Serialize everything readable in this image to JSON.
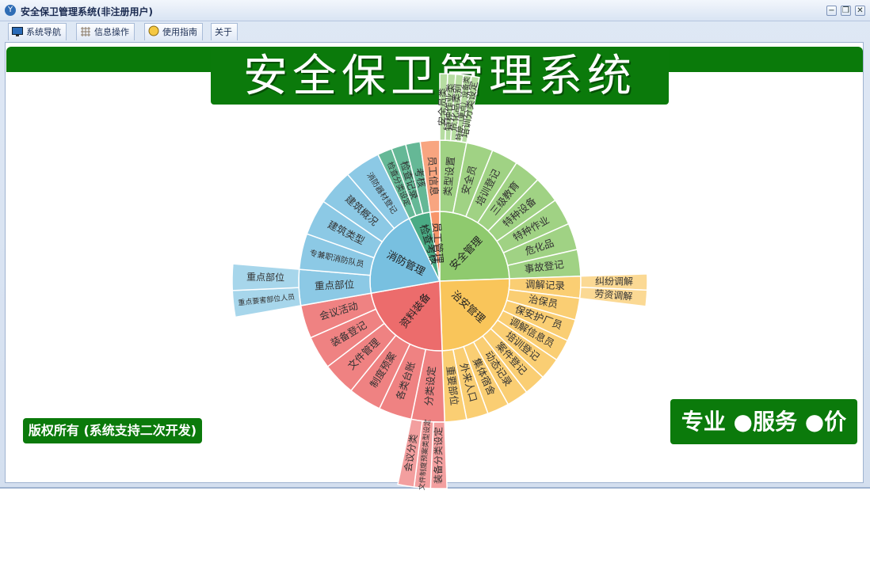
{
  "window": {
    "title": "安全保卫管理系统(非注册用户)",
    "controls": [
      "minimize",
      "restore",
      "close"
    ]
  },
  "toolbar": {
    "tabs": [
      {
        "label": "系统导航",
        "icon": "monitor-icon"
      },
      {
        "label": "信息操作",
        "icon": "grid-icon"
      },
      {
        "label": "使用指南",
        "icon": "lightbulb-icon"
      },
      {
        "label": "关于",
        "icon": ""
      }
    ]
  },
  "main": {
    "banner_title": "安全保卫管理系统",
    "copyright": "版权所有 (系统支持二次开发)",
    "slogan": "专业 ●服务 ●价值"
  },
  "chart_data": {
    "type": "sunburst",
    "categories": [
      {
        "name": "安全管理",
        "color": "#8fca6e",
        "children": [
          "类型设置",
          "安全员",
          "培训登记",
          "三级教育",
          "特种设备",
          "特种作业",
          "危化品",
          "事故登记"
        ],
        "grandchildren": {
          "类型设置": [
            "安全员类",
            "特种作业类",
            "危化品类别",
            "特种（重点）设备类",
            "培训分类设定"
          ]
        }
      },
      {
        "name": "治安管理",
        "color": "#f9c55a",
        "children": [
          "调解记录",
          "治保员",
          "保安护厂员",
          "调解信息员",
          "培训登记",
          "案件登记",
          "动态记录",
          "集体宿舍",
          "外来人口",
          "重要部位"
        ],
        "grandchildren": {
          "调解记录": [
            "纠纷调解",
            "劳资调解"
          ]
        }
      },
      {
        "name": "资料装备",
        "color": "#ec6c6c",
        "children": [
          "分类设定",
          "各类台账",
          "制度预案",
          "文件管理",
          "装备登记",
          "会议活动"
        ],
        "grandchildren": {
          "分类设定": [
            "装备分类设定",
            "文件制度预案类型设定",
            "会议分类"
          ]
        }
      },
      {
        "name": "消防管理",
        "color": "#78c0e0",
        "children": [
          "重点部位",
          "专兼职消防队员",
          "建筑类型",
          "建筑概况",
          "消防器材登记"
        ],
        "grandchildren": {
          "重点部位": [
            "重点要害部位人员",
            "重点部位"
          ]
        }
      },
      {
        "name": "检查考核",
        "color": "#4aab84",
        "children": [
          "检查分类设定",
          "检查记录",
          "考核"
        ]
      },
      {
        "name": "员工管理",
        "color": "#f7956a",
        "children": [
          "员工信息"
        ]
      }
    ]
  }
}
